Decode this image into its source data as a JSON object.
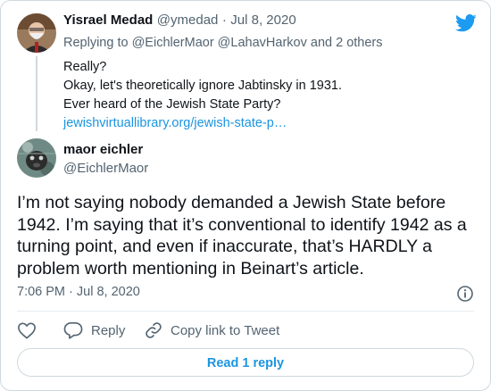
{
  "parent": {
    "name": "Yisrael Medad",
    "handle": "@ymedad",
    "sep": "·",
    "date": "Jul 8, 2020",
    "replying_prefix": "Replying to",
    "replying_targets": "@EichlerMaor @LahavHarkov",
    "replying_suffix": "and 2 others",
    "lines": [
      "Really?",
      "Okay, let's theoretically ignore Jabtinsky in 1931.",
      "Ever heard of the Jewish State Party?"
    ],
    "link": "jewishvirtuallibrary.org/jewish-state-p…"
  },
  "main": {
    "name": "maor eichler",
    "handle": "@EichlerMaor",
    "text": "I’m not saying nobody demanded a Jewish State before 1942. I’m saying that it’s conventional to identify 1942 as a turning point, and even if inaccurate, that’s HARDLY a problem worth mentioning in Beinart’s article.",
    "timestamp": "7:06 PM · Jul 8, 2020"
  },
  "actions": {
    "reply": "Reply",
    "copy_link": "Copy link to Tweet"
  },
  "read_replies": "Read 1 reply",
  "colors": {
    "accent": "#1b95e0",
    "like_icon": "#536471",
    "twitter_logo": "#1d9bf0"
  },
  "icons": [
    "twitter-bird-icon",
    "info-icon",
    "heart-icon",
    "reply-bubble-icon",
    "link-icon"
  ]
}
